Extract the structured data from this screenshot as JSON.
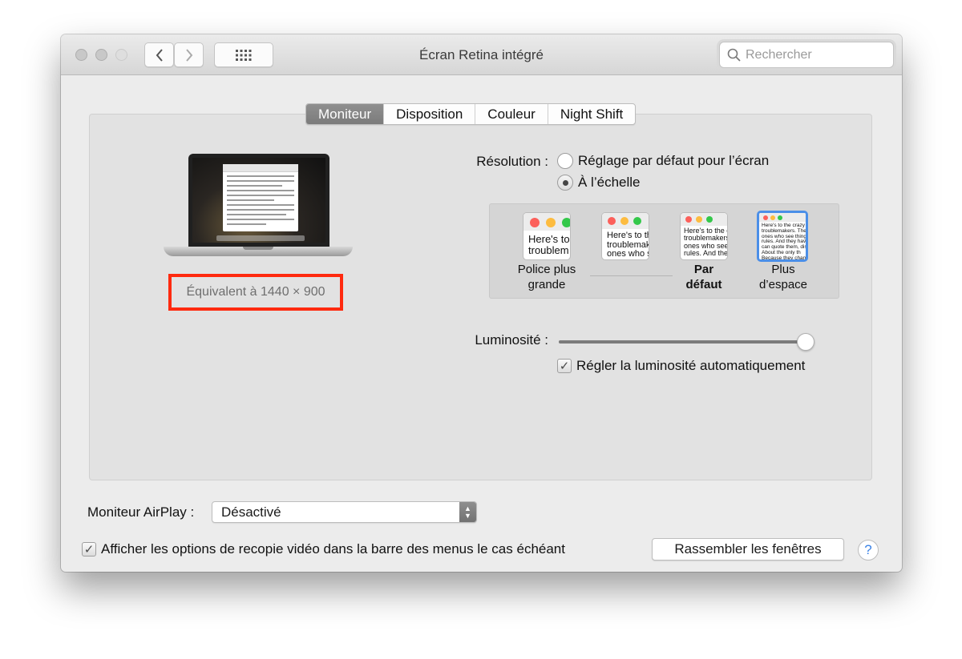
{
  "window": {
    "title": "Écran Retina intégré",
    "search_placeholder": "Rechercher",
    "grid_icon": "show-all-grid-icon",
    "back_icon": "chevron-left-icon",
    "forward_icon": "chevron-right-icon"
  },
  "tabs": [
    {
      "label": "Moniteur",
      "active": true
    },
    {
      "label": "Disposition",
      "active": false
    },
    {
      "label": "Couleur",
      "active": false
    },
    {
      "label": "Night Shift",
      "active": false
    }
  ],
  "preview": {
    "equivalent": "Équivalent à 1440 × 900",
    "highlight_color": "#ff2a0f"
  },
  "resolution": {
    "label": "Résolution :",
    "options": [
      {
        "label": "Réglage par défaut pour l’écran",
        "selected": false
      },
      {
        "label": "À l’échelle",
        "selected": true
      }
    ],
    "scales": [
      {
        "label_line1": "Police plus",
        "label_line2": "grande",
        "sample": "Here's to\ntroublem",
        "bold": false,
        "selected": false
      },
      {
        "label_line1": "",
        "label_line2": "",
        "sample": "Here's to th\ntroublemak\nones who s",
        "bold": false,
        "selected": false
      },
      {
        "label_line1": "Par",
        "label_line2": "défaut",
        "sample": "Here's to the cr\ntroublemakers.\nones who see t\nrules. And they",
        "bold": true,
        "selected": false
      },
      {
        "label_line1": "Plus",
        "label_line2": "d’espace",
        "sample": "Here's to the crazy one\ntroublemakers. The rou\nones who see things dif\nrules. And they have no\ncan quote them, disagr\nAbout the only th\nBecause they change t",
        "bold": false,
        "selected": true
      }
    ]
  },
  "brightness": {
    "label": "Luminosité :",
    "level": 0.99,
    "auto_label": "Régler la luminosité automatiquement",
    "auto_checked": true
  },
  "airplay": {
    "label": "Moniteur AirPlay :",
    "value": "Désactivé"
  },
  "mirroring": {
    "label": "Afficher les options de recopie vidéo dans la barre des menus le cas échéant",
    "checked": true
  },
  "gather_button": "Rassembler les fenêtres",
  "help": "?"
}
